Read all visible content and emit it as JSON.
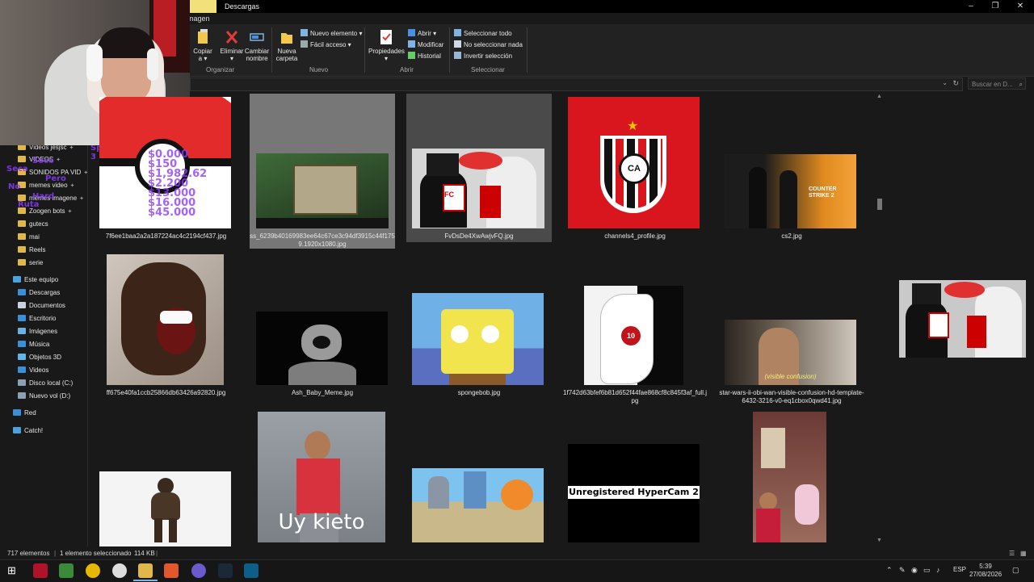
{
  "window": {
    "title": "Descargas",
    "tab_context": "magen",
    "minimize": "–",
    "maximize": "❐",
    "close": "✕"
  },
  "ribbon": {
    "groups": [
      {
        "label": "Organizar"
      },
      {
        "label": "Nuevo"
      },
      {
        "label": "Abrir"
      },
      {
        "label": "Seleccionar"
      }
    ],
    "buttons": {
      "copiar": "Copiar",
      "copiar_sub": "a ▾",
      "eliminar": "Eliminar",
      "eliminar_sub": "▾",
      "cambiar": "Cambiar",
      "cambiar_sub": "nombre",
      "nueva": "Nueva",
      "nueva_sub": "carpeta",
      "nuevo_elemento": "Nuevo elemento ▾",
      "facil_acceso": "Fácil acceso ▾",
      "propiedades": "Propiedades",
      "propiedades_sub": "▾",
      "abrir": "Abrir ▾",
      "modificar": "Modificar",
      "historial": "Historial",
      "seleccionar_todo": "Seleccionar todo",
      "no_seleccionar": "No seleccionar nada",
      "invertir": "Invertir selección"
    }
  },
  "search": {
    "placeholder": "Buscar en D..."
  },
  "nav": {
    "quick": [
      {
        "label": "Videos jesjsc"
      },
      {
        "label": "VIDEOS"
      },
      {
        "label": "SONIDOS PA VID"
      },
      {
        "label": "memes video"
      },
      {
        "label": "memes imagene"
      },
      {
        "label": "Zoogen bots"
      },
      {
        "label": "gutecs"
      },
      {
        "label": "mai"
      },
      {
        "label": "Reels"
      },
      {
        "label": "serie"
      }
    ],
    "este_equipo": "Este equipo",
    "pc_items": [
      {
        "label": "Descargas"
      },
      {
        "label": "Documentos"
      },
      {
        "label": "Escritorio"
      },
      {
        "label": "Imágenes"
      },
      {
        "label": "Música"
      },
      {
        "label": "Objetos 3D"
      },
      {
        "label": "Videos"
      },
      {
        "label": "Disco local (C:)"
      },
      {
        "label": "Nuevo vol (D:)"
      }
    ],
    "red": "Red",
    "catch": "Catch!"
  },
  "overlay": {
    "lines": [
      "Sp: 3",
      "Seco",
      "Seca",
      "Pero",
      "No",
      "Hard",
      "Ruta"
    ]
  },
  "files": [
    {
      "name": "7f6ee1baa2a2a187224ac4c2194cf437.jpg",
      "overlay_values": [
        "$0.000",
        "$150",
        "$1,982.62",
        "$2.200",
        "$13.000",
        "$16.000",
        "$45.000"
      ]
    },
    {
      "name": "ss_6239b40169983ee64c67ce3c94df3915c44f1759.1920x1080.jpg",
      "selected": true
    },
    {
      "name": "FvDsDe4XwAwjvFQ.jpg",
      "hover": true,
      "badge": "FC"
    },
    {
      "name": "channels4_profile.jpg",
      "logo_letters": "CA"
    },
    {
      "name": "cs2.jpg",
      "logo_text": "COUNTER STRIKE 2"
    },
    {
      "name": "ff675e40fa1ccb25866db63426a92820.jpg"
    },
    {
      "name": "Ash_Baby_Meme.jpg"
    },
    {
      "name": "spongebob.jpg"
    },
    {
      "name": "1f742d63bfef6b81d652f44fae868cf8c845f3af_full.jpg",
      "badge": "10"
    },
    {
      "name": "star-wars-ii-obi-wan-visible-confusion-hd-template-6432-3216-v0-eq1cbox0qwd41.jpg",
      "subtitle": "(visible confusion)"
    },
    {
      "name": "",
      "kind": "bigfoot"
    },
    {
      "name": "",
      "caption_text": "Uy kieto"
    },
    {
      "name": "",
      "kind": "spongebob-street"
    },
    {
      "name": "",
      "caption_text": "Unregistered HyperCam 2"
    },
    {
      "name": "",
      "kind": "room"
    }
  ],
  "status": {
    "count": "717 elementos",
    "selected": "1 elemento seleccionado",
    "size": "114 KB"
  },
  "taskbar": {
    "lang": "ESP",
    "time": "5:39",
    "date": "27/08/2026"
  }
}
